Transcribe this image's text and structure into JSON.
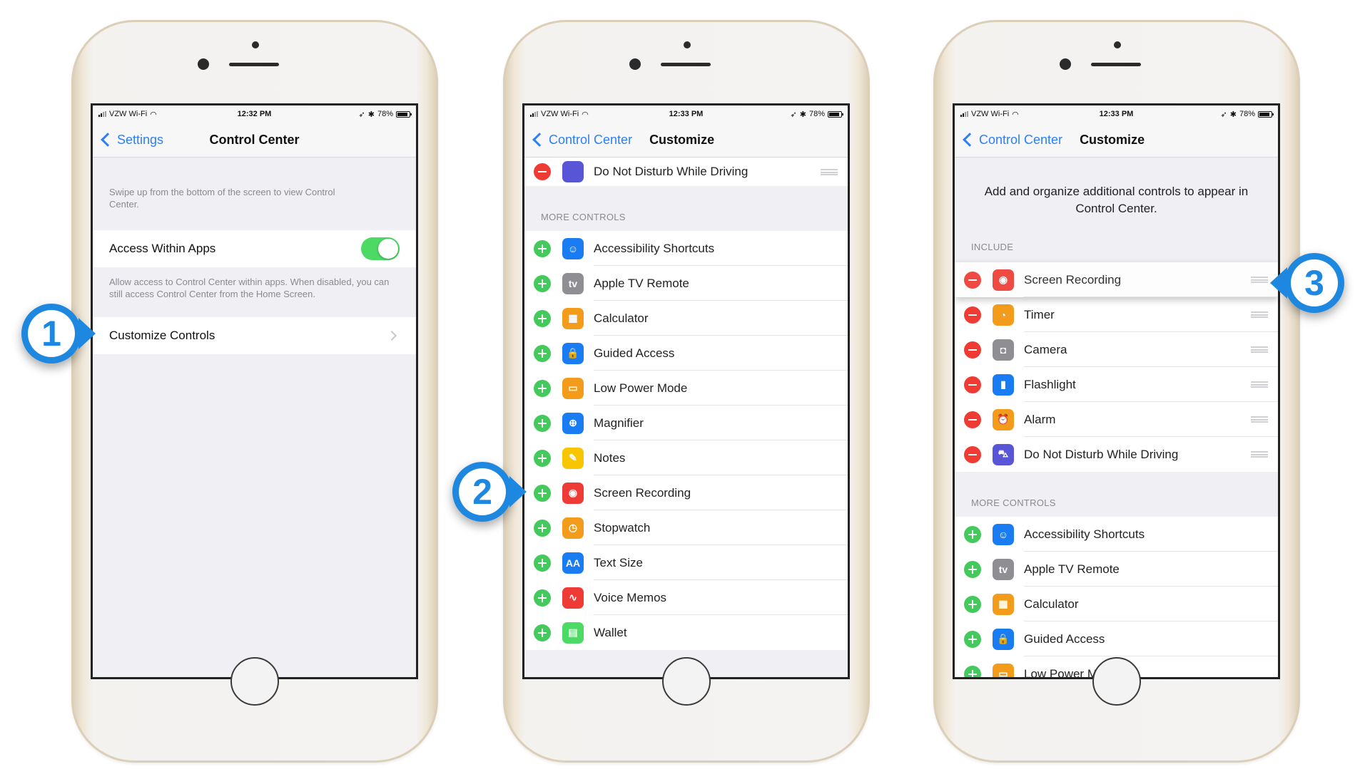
{
  "colors": {
    "accent_blue": "#2d7ff9",
    "toggle_green": "#4cd964",
    "remove_red": "#f03b35",
    "add_green": "#44c95c",
    "callout_blue": "#1e88e0"
  },
  "phones": [
    {
      "status": {
        "carrier": "VZW Wi-Fi",
        "time": "12:32 PM",
        "battery": "78%"
      },
      "nav": {
        "back": "Settings",
        "title": "Control Center"
      },
      "intro_footnote": "Swipe up from the bottom of the screen to view Control Center.",
      "access_within_apps": {
        "label": "Access Within Apps",
        "enabled": true
      },
      "access_footnote": "Allow access to Control Center within apps. When disabled, you can still access Control Center from the Home Screen.",
      "customize_controls": {
        "label": "Customize Controls"
      }
    },
    {
      "status": {
        "carrier": "VZW Wi-Fi",
        "time": "12:33 PM",
        "battery": "78%"
      },
      "nav": {
        "back": "Control Center",
        "title": "Customize"
      },
      "included": [
        {
          "label": "Do Not Disturb While Driving",
          "icon": "car-icon",
          "color": "#5856d6"
        }
      ],
      "more_header": "MORE CONTROLS",
      "more": [
        {
          "label": "Accessibility Shortcuts",
          "icon": "accessibility-icon",
          "color": "#1a7cf2",
          "glyph": "☺"
        },
        {
          "label": "Apple TV Remote",
          "icon": "apple-tv-icon",
          "color": "#8e8e93",
          "glyph": "tv"
        },
        {
          "label": "Calculator",
          "icon": "calculator-icon",
          "color": "#f39c1b",
          "glyph": "▦"
        },
        {
          "label": "Guided Access",
          "icon": "lock-icon",
          "color": "#1a7cf2",
          "glyph": "🔒"
        },
        {
          "label": "Low Power Mode",
          "icon": "battery-icon",
          "color": "#f39c1b",
          "glyph": "▭"
        },
        {
          "label": "Magnifier",
          "icon": "magnifier-icon",
          "color": "#1a7cf2",
          "glyph": "⊕"
        },
        {
          "label": "Notes",
          "icon": "notes-icon",
          "color": "#f7c600",
          "glyph": "✎"
        },
        {
          "label": "Screen Recording",
          "icon": "screen-recording-icon",
          "color": "#ee3b35",
          "glyph": "◉"
        },
        {
          "label": "Stopwatch",
          "icon": "stopwatch-icon",
          "color": "#f39c1b",
          "glyph": "◷"
        },
        {
          "label": "Text Size",
          "icon": "text-size-icon",
          "color": "#1a7cf2",
          "glyph": "AA"
        },
        {
          "label": "Voice Memos",
          "icon": "voice-memos-icon",
          "color": "#ee3b35",
          "glyph": "∿"
        },
        {
          "label": "Wallet",
          "icon": "wallet-icon",
          "color": "#4cd964",
          "glyph": "▤"
        }
      ]
    },
    {
      "status": {
        "carrier": "VZW Wi-Fi",
        "time": "12:33 PM",
        "battery": "78%"
      },
      "nav": {
        "back": "Control Center",
        "title": "Customize"
      },
      "intro": "Add and organize additional controls to appear in Control Center.",
      "include_header": "INCLUDE",
      "included": [
        {
          "label": "Screen Recording",
          "icon": "screen-recording-icon",
          "color": "#ee3b35",
          "glyph": "◉"
        },
        {
          "label": "Timer",
          "icon": "timer-icon",
          "color": "#f39c1b",
          "glyph": "◔"
        },
        {
          "label": "Camera",
          "icon": "camera-icon",
          "color": "#8e8e93",
          "glyph": "◘"
        },
        {
          "label": "Flashlight",
          "icon": "flashlight-icon",
          "color": "#1a7cf2",
          "glyph": "▮"
        },
        {
          "label": "Alarm",
          "icon": "alarm-icon",
          "color": "#f39c1b",
          "glyph": "⏰"
        },
        {
          "label": "Do Not Disturb While Driving",
          "icon": "car-icon",
          "color": "#5856d6",
          "glyph": "⛍"
        }
      ],
      "more_header": "MORE CONTROLS",
      "more": [
        {
          "label": "Accessibility Shortcuts",
          "icon": "accessibility-icon",
          "color": "#1a7cf2",
          "glyph": "☺"
        },
        {
          "label": "Apple TV Remote",
          "icon": "apple-tv-icon",
          "color": "#8e8e93",
          "glyph": "tv"
        },
        {
          "label": "Calculator",
          "icon": "calculator-icon",
          "color": "#f39c1b",
          "glyph": "▦"
        },
        {
          "label": "Guided Access",
          "icon": "lock-icon",
          "color": "#1a7cf2",
          "glyph": "🔒"
        },
        {
          "label": "Low Power Mode",
          "icon": "battery-icon",
          "color": "#f39c1b",
          "glyph": "▭"
        }
      ]
    }
  ],
  "callouts": [
    {
      "number": "1"
    },
    {
      "number": "2"
    },
    {
      "number": "3"
    }
  ]
}
